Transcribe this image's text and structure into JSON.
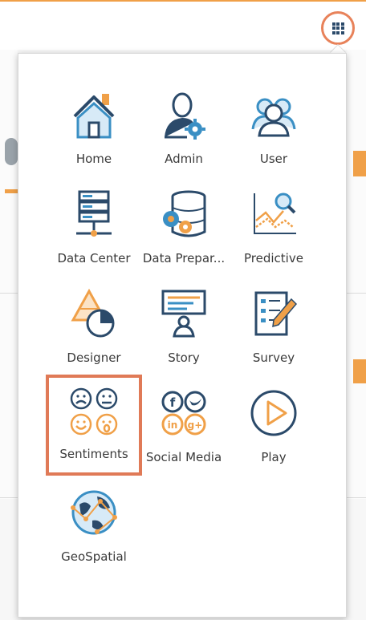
{
  "header": {
    "apps_button_icon": "grid-icon"
  },
  "menu": {
    "items": [
      {
        "label": "Home",
        "icon": "home-icon"
      },
      {
        "label": "Admin",
        "icon": "admin-gear-icon"
      },
      {
        "label": "User",
        "icon": "users-icon"
      },
      {
        "label": "Data Center",
        "icon": "server-icon"
      },
      {
        "label": "Data Prepar...",
        "icon": "database-gears-icon"
      },
      {
        "label": "Predictive",
        "icon": "predictive-chart-icon"
      },
      {
        "label": "Designer",
        "icon": "designer-pyramid-pie-icon"
      },
      {
        "label": "Story",
        "icon": "story-presenter-icon"
      },
      {
        "label": "Survey",
        "icon": "survey-checklist-icon"
      },
      {
        "label": "Sentiments",
        "icon": "sentiment-faces-icon",
        "selected": true
      },
      {
        "label": "Social Media",
        "icon": "social-media-icon"
      },
      {
        "label": "Play",
        "icon": "play-icon"
      },
      {
        "label": "GeoSpatial",
        "icon": "globe-network-icon"
      }
    ]
  },
  "colors": {
    "accent": "#e07a57",
    "icon_dark": "#2b4a6a",
    "icon_blue": "#3a8fc4",
    "icon_orange": "#f0a048",
    "top_border": "#f0a048"
  }
}
